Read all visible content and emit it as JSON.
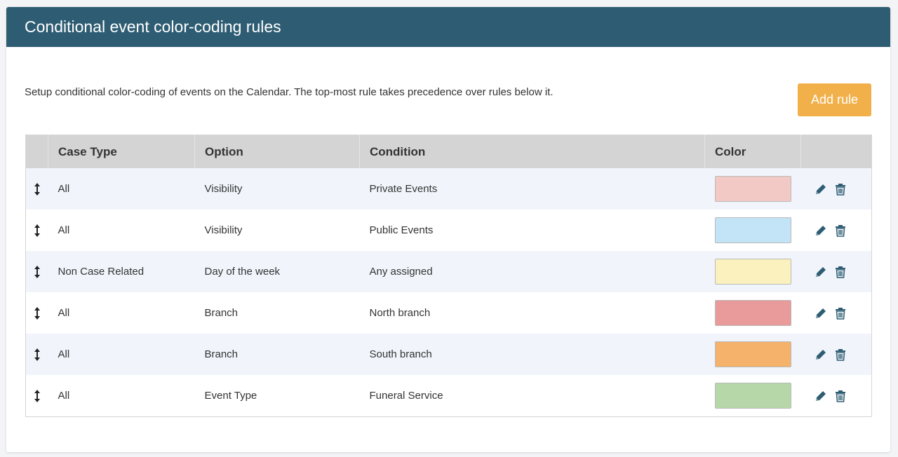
{
  "panel": {
    "title": "Conditional event color-coding rules",
    "description": "Setup conditional color-coding of events on the Calendar. The top-most rule takes precedence over rules below it.",
    "add_rule_label": "Add rule"
  },
  "table": {
    "headers": {
      "case_type": "Case Type",
      "option": "Option",
      "condition": "Condition",
      "color": "Color"
    },
    "rows": [
      {
        "case_type": "All",
        "option": "Visibility",
        "condition": "Private Events",
        "color": "#f2c9c5"
      },
      {
        "case_type": "All",
        "option": "Visibility",
        "condition": "Public Events",
        "color": "#c3e4f6"
      },
      {
        "case_type": "Non Case Related",
        "option": "Day of the week",
        "condition": "Any assigned",
        "color": "#fbf1be"
      },
      {
        "case_type": "All",
        "option": "Branch",
        "condition": "North branch",
        "color": "#e99a9a"
      },
      {
        "case_type": "All",
        "option": "Branch",
        "condition": "South branch",
        "color": "#f5b26b"
      },
      {
        "case_type": "All",
        "option": "Event Type",
        "condition": "Funeral Service",
        "color": "#b6d7a8"
      }
    ]
  },
  "icons": {
    "drag": "drag-handle-icon",
    "edit": "pencil-icon",
    "delete": "trash-icon"
  },
  "colors": {
    "header_bg": "#2e5d73",
    "accent_button": "#f2b04a",
    "icon_color": "#2e5d73",
    "row_stripe": "#f1f5fb"
  }
}
